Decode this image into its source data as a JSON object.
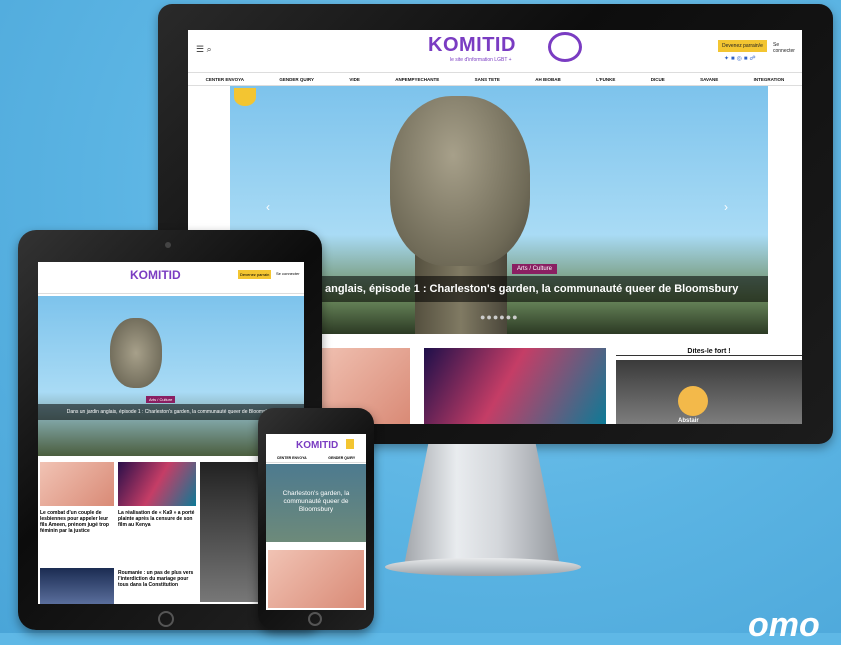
{
  "desktop": {
    "logo": "KOMITID",
    "tagline": "le site d'information LGBT +",
    "donate_label": "Devenez parrain/e",
    "login_label": "Se connecter",
    "nav": [
      "CENTER ENVOYA",
      "GENDER QUIRY",
      "VIDE",
      "ANPEMPYECHANTE",
      "SANS TETE",
      "AH BIOBAB",
      "L'FUNKE",
      "DICUE",
      "SAVANE",
      "INTEGRATION"
    ],
    "hero_badge": "Arts / Culture",
    "hero_title": "us un jardin anglais, épisode 1 : Charleston's garden, la communauté queer de Bloomsbury",
    "sidebar_title": "Dites-le fort !",
    "poll_label": "Abstair"
  },
  "tablet": {
    "logo": "KOMITID",
    "donate_label": "Devenez parrain",
    "login_label": "Se connecter",
    "hero_badge": "Arts / Culture",
    "hero_title": "Dans un jardin anglais, épisode 1 : Charleston's garden, la communauté queer de Bloomsbury",
    "article1": "Le combat d'un couple de lesbiennes pour appeler leur fils Ameen, prénom jugé trop féminin par la justice",
    "article2": "La réalisation de « Ka9 » a porté plainte après la censure de son film au Kenya",
    "article3": "Roumanie : un pas de plus vers l'interdiction du mariage pour tous dans la Constitution"
  },
  "phone": {
    "logo": "KOMITID",
    "nav": [
      "CENTER ENVOYA",
      "GENDER QUIRY"
    ],
    "hero_caption": "Charleston's garden, la communauté queer de Bloomsbury"
  },
  "watermark": "omo",
  "colors": {
    "brand": "#7a3cc2",
    "accent": "#f3c531",
    "badge": "#8a1f62",
    "background": "#5fb8e6"
  }
}
